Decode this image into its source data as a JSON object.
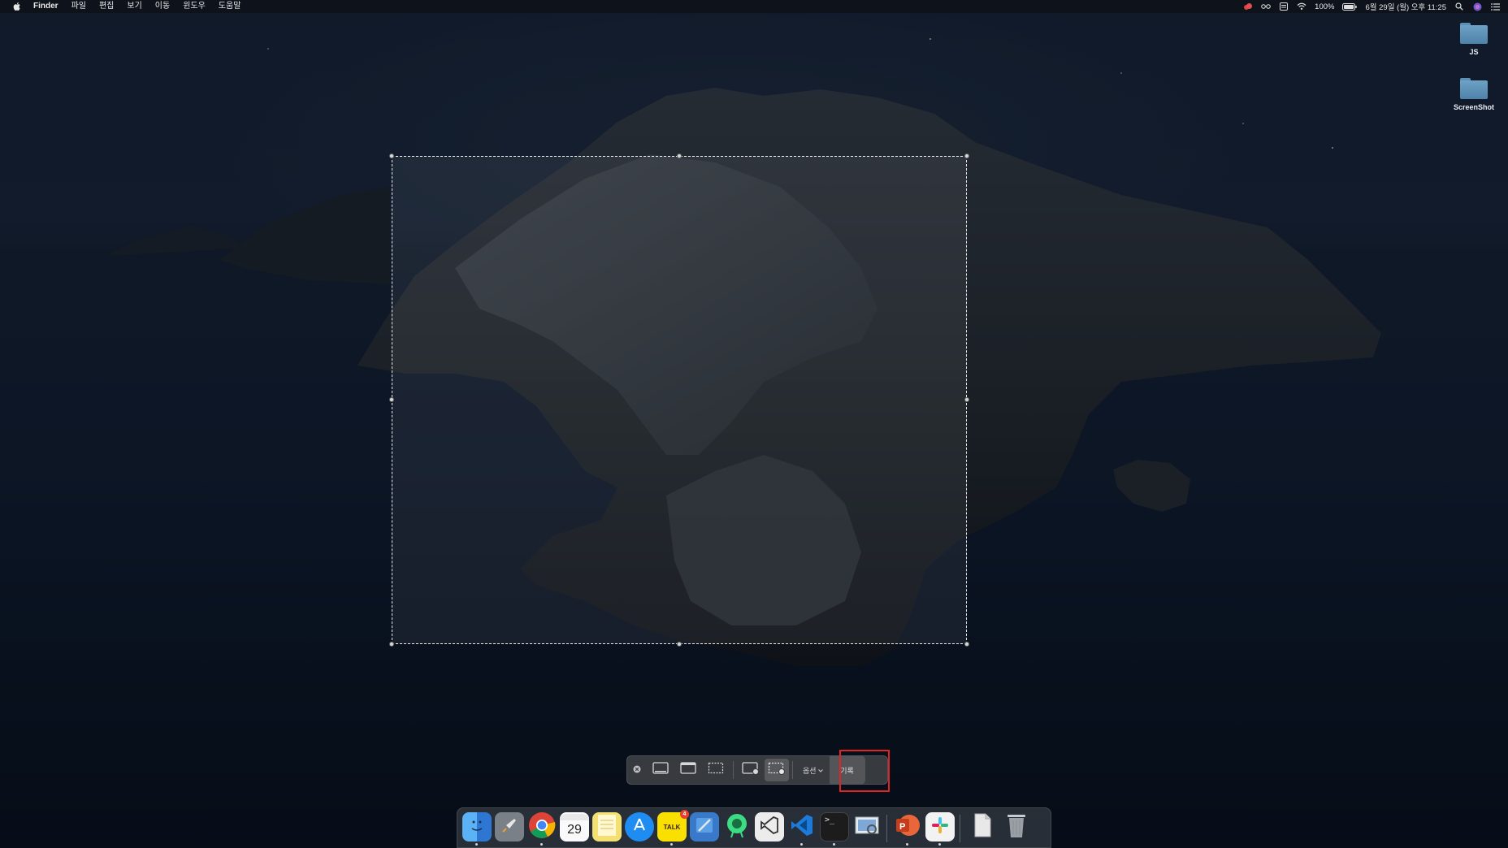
{
  "menubar": {
    "apple_icon": "apple-logo",
    "items": [
      "Finder",
      "파일",
      "편집",
      "보기",
      "이동",
      "윈도우",
      "도움말"
    ],
    "status": {
      "battery": "100%",
      "datetime": "6월 29일 (월) 오후 11:25"
    }
  },
  "desktop": {
    "icons": [
      {
        "label": "JS",
        "icon": "folder-icon"
      },
      {
        "label": "ScreenShot",
        "icon": "folder-icon"
      }
    ]
  },
  "screenshot_toolbar": {
    "buttons": [
      {
        "name": "close",
        "icon": "close-icon"
      },
      {
        "name": "capture-entire-screen",
        "icon": "screen-icon"
      },
      {
        "name": "capture-window",
        "icon": "window-icon"
      },
      {
        "name": "capture-selection",
        "icon": "selection-icon"
      },
      {
        "name": "record-entire-screen",
        "icon": "record-screen-icon"
      },
      {
        "name": "record-selection",
        "icon": "record-selection-icon",
        "active": true
      }
    ],
    "options_label": "옵션",
    "record_label": "기록"
  },
  "dock": {
    "apps": [
      {
        "name": "Finder",
        "icon": "finder-icon",
        "color": "#3a8ee6"
      },
      {
        "name": "Launchpad",
        "icon": "rocket-icon",
        "color": "#8a8f98"
      },
      {
        "name": "Chrome",
        "icon": "chrome-icon",
        "color": "#db4437"
      },
      {
        "name": "Calendar",
        "icon": "calendar-icon",
        "color": "#ffffff",
        "text": "29"
      },
      {
        "name": "Notes",
        "icon": "notes-icon",
        "color": "#f6e27a"
      },
      {
        "name": "App Store",
        "icon": "appstore-icon",
        "color": "#1f8cf1"
      },
      {
        "name": "KakaoTalk",
        "icon": "kakaotalk-icon",
        "color": "#f9e000",
        "text": "TALK",
        "badge": "4"
      },
      {
        "name": "Xcode",
        "icon": "xcode-icon",
        "color": "#3a78c9"
      },
      {
        "name": "Android Studio",
        "icon": "android-studio-icon",
        "color": "#3ddc84"
      },
      {
        "name": "Visual Studio Code Insiders",
        "icon": "vscode-light-icon",
        "color": "#e6e6e6"
      },
      {
        "name": "Visual Studio Code",
        "icon": "vscode-icon",
        "color": "#1e7ad8"
      },
      {
        "name": "Terminal",
        "icon": "terminal-icon",
        "color": "#1c1c1c"
      },
      {
        "name": "Preview",
        "icon": "preview-icon",
        "color": "#7ea8d8"
      },
      {
        "name": "PowerPoint",
        "icon": "powerpoint-icon",
        "color": "#d24726"
      },
      {
        "name": "Slack",
        "icon": "slack-icon",
        "color": "#e8e8e8"
      },
      {
        "name": "Documents",
        "icon": "document-icon",
        "color": "#cfcfcf"
      },
      {
        "name": "Trash",
        "icon": "trash-icon",
        "color": "#b8bcc2"
      }
    ]
  }
}
